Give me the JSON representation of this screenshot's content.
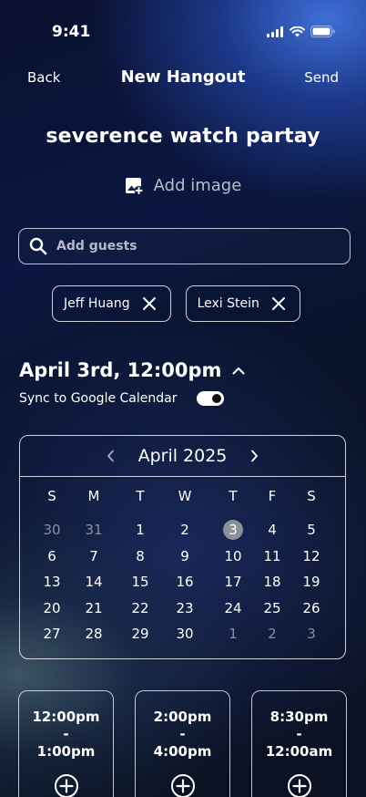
{
  "status_bar": {
    "time": "9:41"
  },
  "nav": {
    "back": "Back",
    "title": "New Hangout",
    "send": "Send"
  },
  "hangout": {
    "title": "severence watch partay",
    "add_image": "Add image"
  },
  "guests": {
    "placeholder": "Add guests",
    "chips": [
      "Jeff Huang",
      "Lexi Stein"
    ]
  },
  "event": {
    "datetime": "April 3rd, 12:00pm",
    "sync_label": "Sync to Google Calendar",
    "sync_on": true
  },
  "calendar": {
    "month": "April 2025",
    "weekdays": [
      "S",
      "M",
      "T",
      "W",
      "T",
      "F",
      "S"
    ],
    "weeks": [
      [
        {
          "d": "30",
          "muted": true
        },
        {
          "d": "31",
          "muted": true
        },
        {
          "d": "1"
        },
        {
          "d": "2"
        },
        {
          "d": "3",
          "selected": true
        },
        {
          "d": "4"
        },
        {
          "d": "5"
        }
      ],
      [
        {
          "d": "6"
        },
        {
          "d": "7"
        },
        {
          "d": "8"
        },
        {
          "d": "9"
        },
        {
          "d": "10"
        },
        {
          "d": "11"
        },
        {
          "d": "12"
        }
      ],
      [
        {
          "d": "13"
        },
        {
          "d": "14"
        },
        {
          "d": "15"
        },
        {
          "d": "16"
        },
        {
          "d": "17"
        },
        {
          "d": "18"
        },
        {
          "d": "19"
        }
      ],
      [
        {
          "d": "20"
        },
        {
          "d": "21"
        },
        {
          "d": "22"
        },
        {
          "d": "23"
        },
        {
          "d": "24"
        },
        {
          "d": "25"
        },
        {
          "d": "26"
        }
      ],
      [
        {
          "d": "27"
        },
        {
          "d": "28"
        },
        {
          "d": "29"
        },
        {
          "d": "30"
        },
        {
          "d": "1",
          "muted": true
        },
        {
          "d": "2",
          "muted": true
        },
        {
          "d": "3",
          "muted": true
        }
      ]
    ]
  },
  "time_slots": [
    {
      "start": "12:00pm",
      "sep": "-",
      "end": "1:00pm"
    },
    {
      "start": "2:00pm",
      "sep": "-",
      "end": "4:00pm"
    },
    {
      "start": "8:30pm",
      "sep": "-",
      "end": "12:00am"
    }
  ]
}
